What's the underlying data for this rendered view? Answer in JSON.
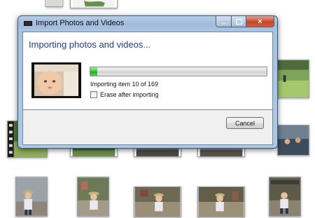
{
  "dialog": {
    "title": "Import Photos and Videos",
    "heading": "Importing photos and videos...",
    "progress_fraction": 0.04,
    "status": "Importing item 10 of 169",
    "erase_label": "Erase after importing",
    "erase_checked": false,
    "cancel_label": "Cancel",
    "caption_buttons": {
      "minimize_icon": "minimize-icon",
      "maximize_icon": "maximize-icon",
      "close_icon": "close-icon",
      "close_glyph": "×"
    }
  },
  "colors": {
    "heading_text": "#1e3f8c",
    "progress_green": "#37c837",
    "frame_blue": "#a9c3e0",
    "close_red": "#c8462b"
  }
}
